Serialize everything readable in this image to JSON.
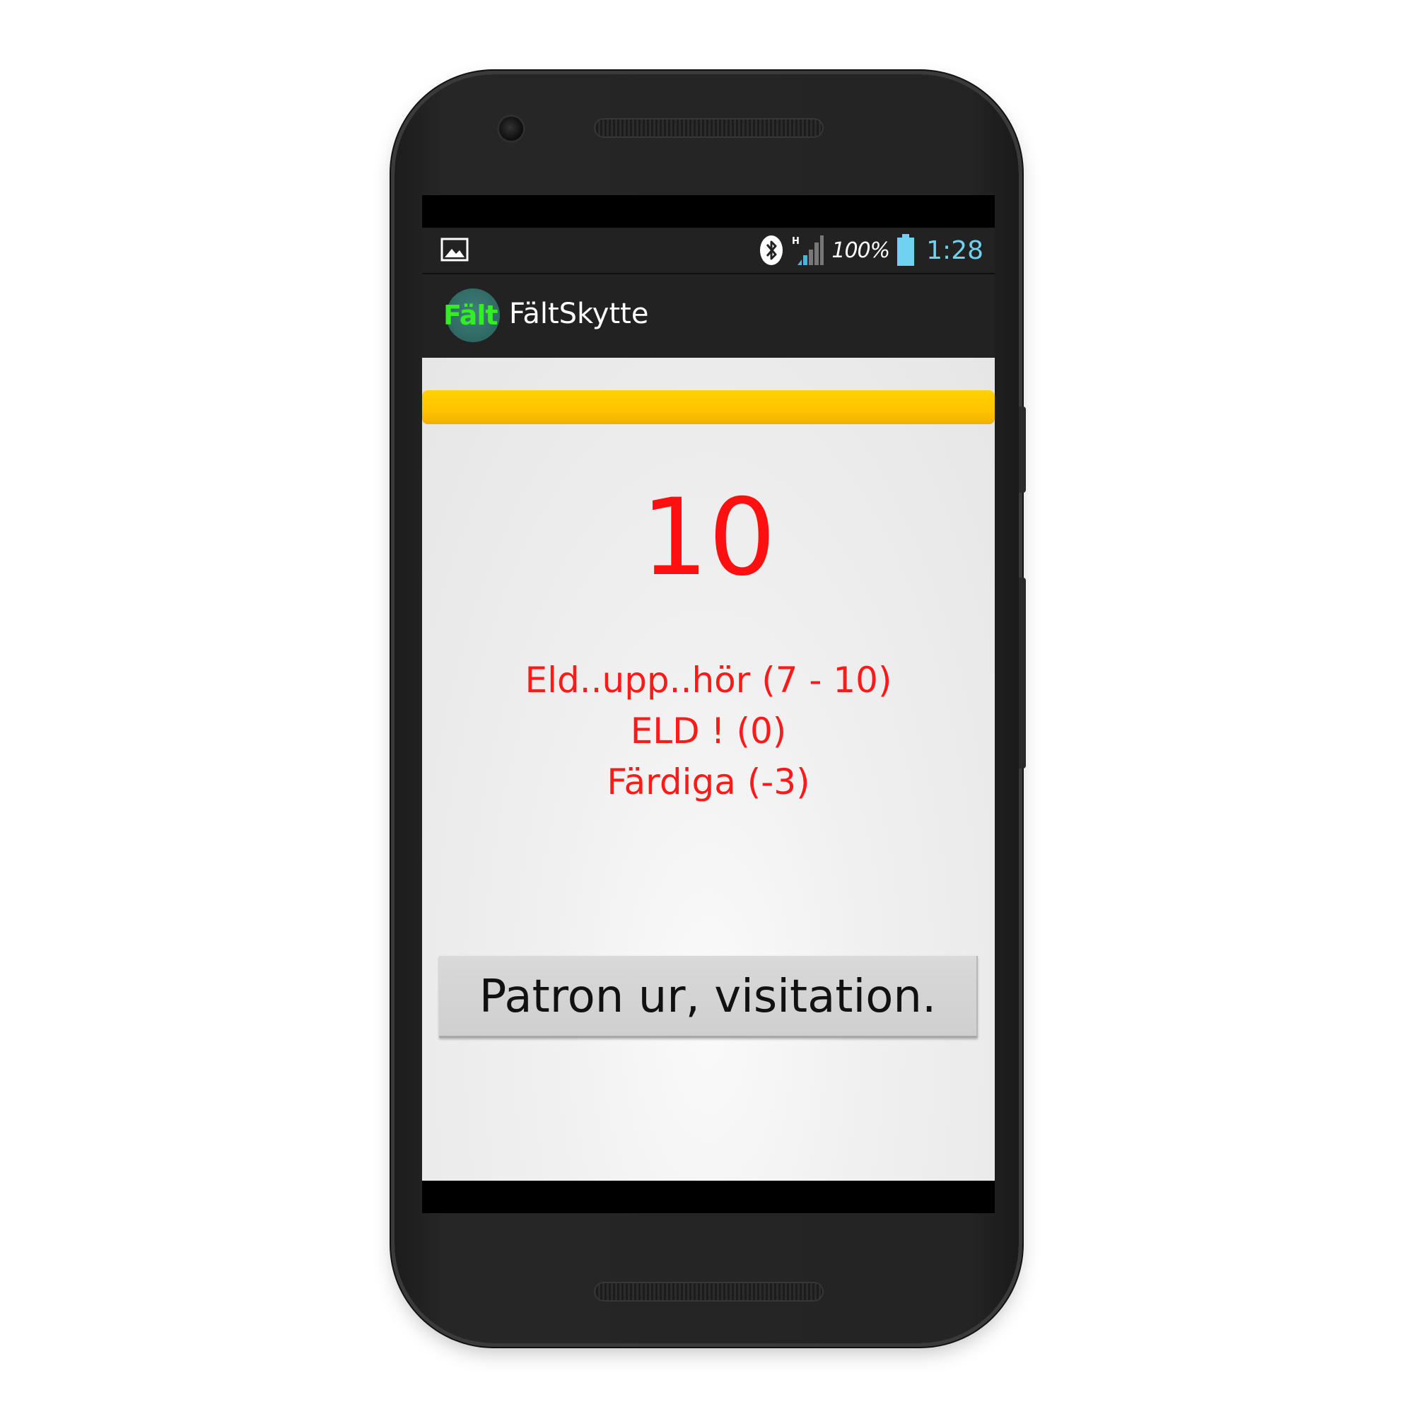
{
  "status_bar": {
    "image_icon": "image-icon",
    "bluetooth_icon": "bluetooth-icon",
    "signal_icon": "signal-icon",
    "signal_label": "H",
    "battery_text": "100%",
    "battery_icon": "battery-icon",
    "clock": "1:28"
  },
  "action_bar": {
    "app_icon_label": "Fält",
    "title": "FältSkytte"
  },
  "main": {
    "progress_bar_color": "#ffc400",
    "countdown": "10",
    "commands": [
      "Eld..upp..hör (7 - 10)",
      "ELD ! (0)",
      "Färdiga (-3)"
    ],
    "button_label": "Patron ur, visitation."
  },
  "colors": {
    "command_text": "#ff1a1a",
    "clock": "#6fd3f0",
    "app_icon_text": "#33ee22",
    "action_bar": "#222222"
  }
}
